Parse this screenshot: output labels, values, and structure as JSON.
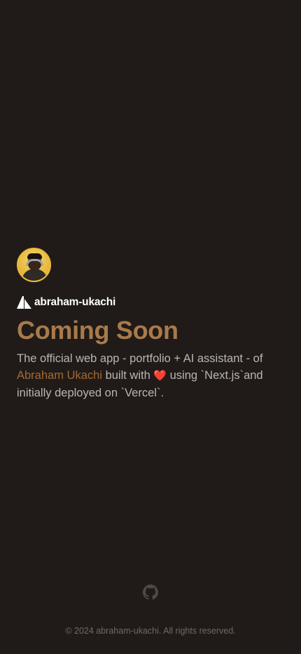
{
  "brand": {
    "name": "abraham-ukachi"
  },
  "hero": {
    "title": "Coming Soon",
    "desc_part1": "The official web app - portfolio + AI assistant - of ",
    "desc_author": "Abraham Ukachi",
    "desc_part2": " built with ",
    "desc_heart": "❤️",
    "desc_part3": "  using `Next.js`and initially deployed on `Vercel`."
  },
  "footer": {
    "copyright": "© 2024 abraham-ukachi. All rights reserved."
  },
  "icons": {
    "avatar": "profile-photo",
    "logo": "triangle-a-logo",
    "github": "github-icon"
  },
  "colors": {
    "background": "#201b18",
    "accent": "#a97a4b",
    "link": "#a36a32",
    "text": "#b9b5b1"
  }
}
